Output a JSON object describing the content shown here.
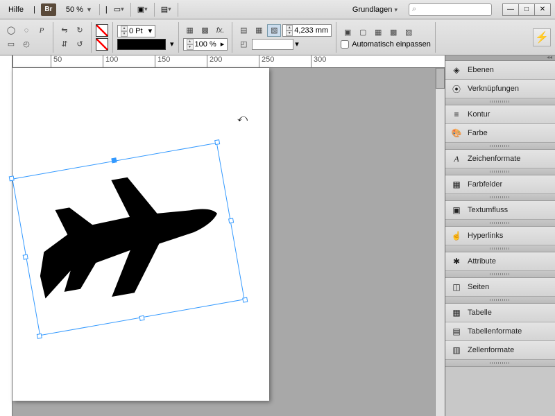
{
  "menubar": {
    "help": "Hilfe",
    "bridge": "Br",
    "zoom": "50 %",
    "workspace": "Grundlagen",
    "search_placeholder": "⌕"
  },
  "toolbar": {
    "stroke_pt": "0 Pt",
    "opacity": "100 %",
    "measure": "4,233 mm",
    "autofit": "Automatisch einpassen"
  },
  "ruler": {
    "t50": "50",
    "t100": "100",
    "t150": "150",
    "t200": "200",
    "t250": "250",
    "t300": "300"
  },
  "panels": {
    "ebenen": "Ebenen",
    "verknuepfungen": "Verknüpfungen",
    "kontur": "Kontur",
    "farbe": "Farbe",
    "zeichenformate": "Zeichenformate",
    "farbfelder": "Farbfelder",
    "textumfluss": "Textumfluss",
    "hyperlinks": "Hyperlinks",
    "attribute": "Attribute",
    "seiten": "Seiten",
    "tabelle": "Tabelle",
    "tabellenformate": "Tabellenformate",
    "zellenformate": "Zellenformate"
  }
}
